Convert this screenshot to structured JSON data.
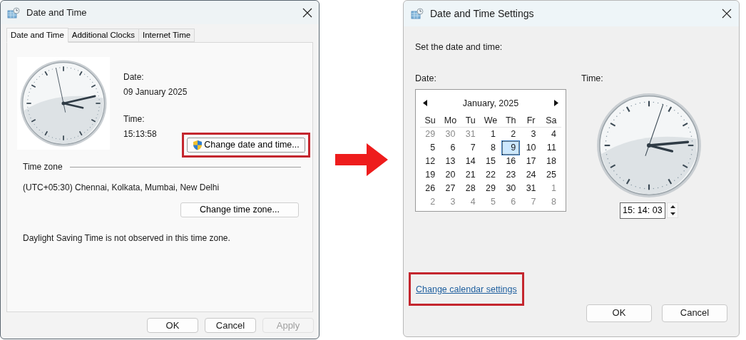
{
  "date_time_dialog": {
    "title": "Date and Time",
    "tabs": [
      {
        "label": "Date and Time",
        "selected": true
      },
      {
        "label": "Additional Clocks",
        "selected": false
      },
      {
        "label": "Internet Time",
        "selected": false
      }
    ],
    "date_label": "Date:",
    "date_value": "09 January 2025",
    "time_label": "Time:",
    "time_value": "15:13:58",
    "change_button": {
      "label": "Change date and time...",
      "highlighted": true
    },
    "time_zone_heading": "Time zone",
    "time_zone_value": "(UTC+05:30) Chennai, Kolkata, Mumbai, New Delhi",
    "change_zone_button": {
      "label": "Change time zone...",
      "highlighted": false
    },
    "dst_note": "Daylight Saving Time is not observed in this time zone.",
    "buttons": [
      {
        "label": "OK",
        "disabled": false
      },
      {
        "label": "Cancel",
        "disabled": false
      },
      {
        "label": "Apply",
        "disabled": true
      }
    ]
  },
  "settings_dialog": {
    "title": "Date and Time Settings",
    "prompt": "Set the date and time:",
    "date_label": "Date:",
    "time_label": "Time:",
    "calendar": {
      "month": "January, 2025",
      "weekdays": [
        "Su",
        "Mo",
        "Tu",
        "We",
        "Th",
        "Fr",
        "Sa"
      ],
      "days": [
        {
          "text": "29",
          "other_month": true,
          "selected": false
        },
        {
          "text": "30",
          "other_month": true,
          "selected": false
        },
        {
          "text": "31",
          "other_month": true,
          "selected": false
        },
        {
          "text": "1",
          "other_month": false,
          "selected": false
        },
        {
          "text": "2",
          "other_month": false,
          "selected": false
        },
        {
          "text": "3",
          "other_month": false,
          "selected": false
        },
        {
          "text": "4",
          "other_month": false,
          "selected": false
        },
        {
          "text": "5",
          "other_month": false,
          "selected": false
        },
        {
          "text": "6",
          "other_month": false,
          "selected": false
        },
        {
          "text": "7",
          "other_month": false,
          "selected": false
        },
        {
          "text": "8",
          "other_month": false,
          "selected": false
        },
        {
          "text": "9",
          "other_month": false,
          "selected": true
        },
        {
          "text": "10",
          "other_month": false,
          "selected": false
        },
        {
          "text": "11",
          "other_month": false,
          "selected": false
        },
        {
          "text": "12",
          "other_month": false,
          "selected": false
        },
        {
          "text": "13",
          "other_month": false,
          "selected": false
        },
        {
          "text": "14",
          "other_month": false,
          "selected": false
        },
        {
          "text": "15",
          "other_month": false,
          "selected": false
        },
        {
          "text": "16",
          "other_month": false,
          "selected": false
        },
        {
          "text": "17",
          "other_month": false,
          "selected": false
        },
        {
          "text": "18",
          "other_month": false,
          "selected": false
        },
        {
          "text": "19",
          "other_month": false,
          "selected": false
        },
        {
          "text": "20",
          "other_month": false,
          "selected": false
        },
        {
          "text": "21",
          "other_month": false,
          "selected": false
        },
        {
          "text": "22",
          "other_month": false,
          "selected": false
        },
        {
          "text": "23",
          "other_month": false,
          "selected": false
        },
        {
          "text": "24",
          "other_month": false,
          "selected": false
        },
        {
          "text": "25",
          "other_month": false,
          "selected": false
        },
        {
          "text": "26",
          "other_month": false,
          "selected": false
        },
        {
          "text": "27",
          "other_month": false,
          "selected": false
        },
        {
          "text": "28",
          "other_month": false,
          "selected": false
        },
        {
          "text": "29",
          "other_month": false,
          "selected": false
        },
        {
          "text": "30",
          "other_month": false,
          "selected": false
        },
        {
          "text": "31",
          "other_month": false,
          "selected": false
        },
        {
          "text": "1",
          "other_month": true,
          "selected": false
        },
        {
          "text": "2",
          "other_month": true,
          "selected": false
        },
        {
          "text": "3",
          "other_month": true,
          "selected": false
        },
        {
          "text": "4",
          "other_month": true,
          "selected": false
        },
        {
          "text": "5",
          "other_month": true,
          "selected": false
        },
        {
          "text": "6",
          "other_month": true,
          "selected": false
        },
        {
          "text": "7",
          "other_month": true,
          "selected": false
        },
        {
          "text": "8",
          "other_month": true,
          "selected": false
        }
      ]
    },
    "time_field": "15: 14: 03",
    "calendar_link": {
      "label": "Change calendar settings",
      "highlighted": true
    },
    "buttons": [
      {
        "label": "OK",
        "disabled": false
      },
      {
        "label": "Cancel",
        "disabled": false
      }
    ]
  }
}
